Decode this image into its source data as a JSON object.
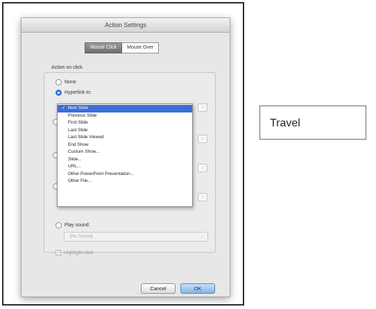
{
  "dialog": {
    "title": "Action Settings",
    "tabs": [
      {
        "label": "Mouse Click",
        "selected": true
      },
      {
        "label": "Mouse Over",
        "selected": false
      }
    ],
    "group_label": "Action on click",
    "options": {
      "none_label": "None",
      "hyperlink_label": "Hyperlink to:"
    },
    "hyperlink_menu": {
      "items": [
        {
          "label": "Next Slide",
          "checked": true
        },
        {
          "label": "Previous Slide",
          "checked": false
        },
        {
          "label": "First Slide",
          "checked": false
        },
        {
          "label": "Last Slide",
          "checked": false
        },
        {
          "label": "Last Slide Viewed",
          "checked": false
        },
        {
          "label": "End Show",
          "checked": false
        },
        {
          "label": "Custom Show...",
          "checked": false
        },
        {
          "label": "Slide...",
          "checked": false
        },
        {
          "label": "URL...",
          "checked": false
        },
        {
          "label": "Other PowerPoint Presentation...",
          "checked": false
        },
        {
          "label": "Other File...",
          "checked": false
        }
      ],
      "check_glyph": "✓"
    },
    "play_sound_label": "Play sound:",
    "sound_select_value": "[No Sound]",
    "highlight_click_label": "Highlight click",
    "cancel_label": "Cancel",
    "ok_label": "OK",
    "select_arrow": "↕",
    "accent_color": "#3b6fd6"
  },
  "side_box": {
    "text": "Travel"
  }
}
